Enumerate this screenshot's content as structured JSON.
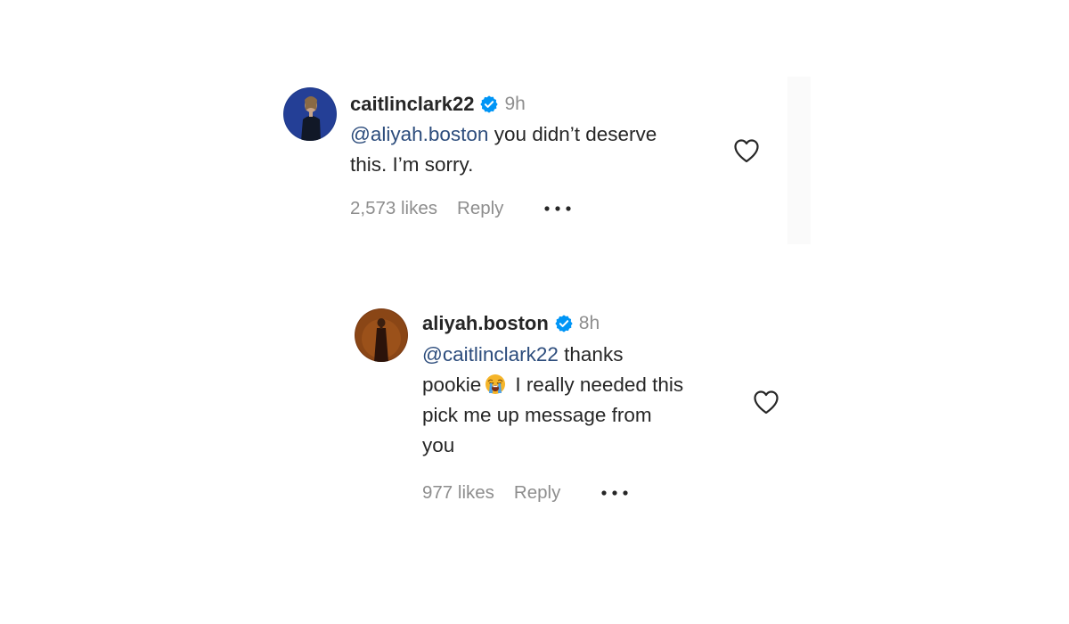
{
  "comments": [
    {
      "username": "caitlinclark22",
      "time": "9h",
      "mention": "@aliyah.boston",
      "lines": [
        " you didn’t deserve",
        "this. I’m sorry."
      ],
      "likes": "2,573 likes",
      "reply_label": "Reply",
      "avatar_icon": "avatar-caitlinclark22",
      "verified_icon": "verified-badge-icon",
      "like_icon": "heart-outline-icon",
      "more_icon": "more-options-icon"
    },
    {
      "username": "aliyah.boston",
      "time": "8h",
      "mention": "@caitlinclark22",
      "line1_rest": " thanks",
      "line2_pre": "pookie",
      "line2_emoji": "loudly-crying-face-emoji",
      "line2_post": "I really needed this",
      "line3": "pick me up message from",
      "line4": "you",
      "likes": "977 likes",
      "reply_label": "Reply",
      "avatar_icon": "avatar-aliyah-boston",
      "verified_icon": "verified-badge-icon",
      "like_icon": "heart-outline-icon",
      "more_icon": "more-options-icon"
    }
  ],
  "colors": {
    "text": "#262626",
    "muted": "#8e8e8e",
    "mention": "#2c4c7c",
    "verified": "#0095f6"
  }
}
